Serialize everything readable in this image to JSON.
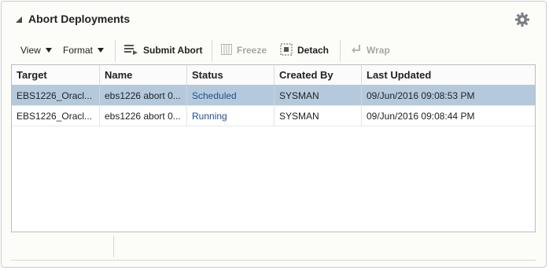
{
  "panel": {
    "title": "Abort Deployments"
  },
  "toolbar": {
    "view_label": "View",
    "format_label": "Format",
    "submit_abort_label": "Submit Abort",
    "freeze_label": "Freeze",
    "detach_label": "Detach",
    "wrap_label": "Wrap"
  },
  "table": {
    "columns": [
      "Target",
      "Name",
      "Status",
      "Created By",
      "Last Updated"
    ],
    "rows": [
      {
        "target": "EBS1226_Oracl...",
        "name": "ebs1226 abort 0...",
        "status": "Scheduled",
        "created_by": "SYSMAN",
        "last_updated": "09/Jun/2016 09:08:53 PM",
        "selected": true
      },
      {
        "target": "EBS1226_Oracl...",
        "name": "ebs1226 abort 0...",
        "status": "Running",
        "created_by": "SYSMAN",
        "last_updated": "09/Jun/2016 09:08:44 PM",
        "selected": false
      }
    ]
  },
  "colors": {
    "selected_row": "#b4cadc",
    "link": "#1f4e8c",
    "disabled": "#a7a7a7"
  },
  "icons": {
    "collapse": "triangle-collapse-icon",
    "settings": "gear-icon",
    "submit_abort": "submit-abort-icon",
    "freeze": "freeze-icon",
    "detach": "detach-icon",
    "wrap": "wrap-icon"
  }
}
